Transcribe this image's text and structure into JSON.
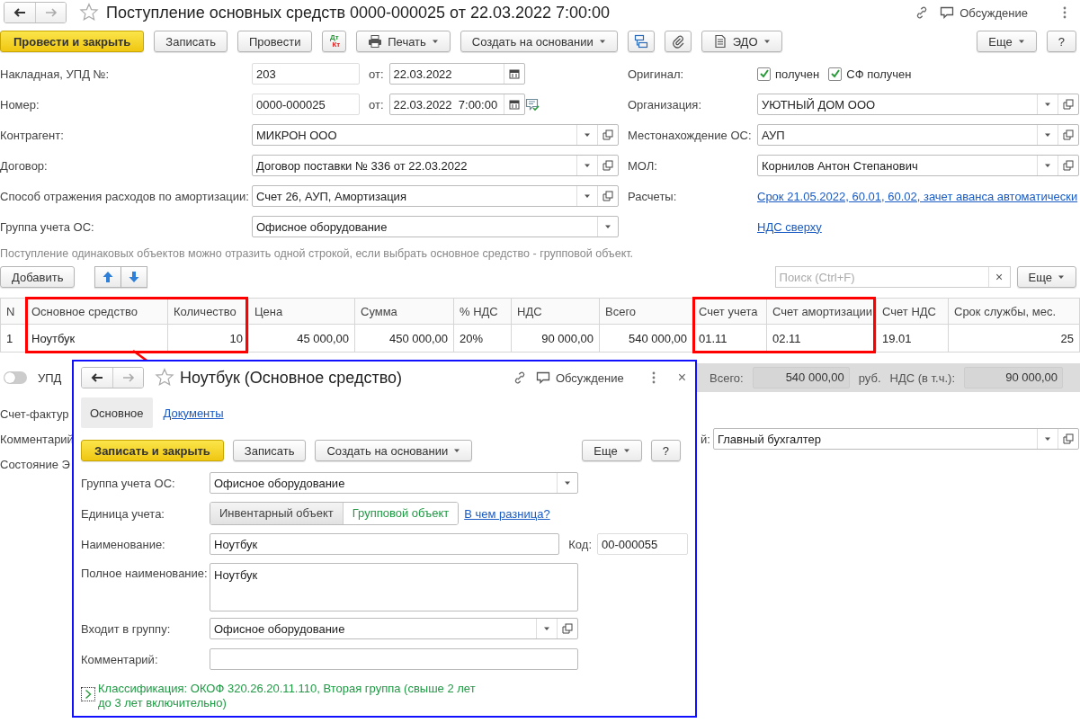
{
  "window": {
    "title": "Поступление основных средств 0000-000025 от 22.03.2022 7:00:00",
    "discussion": "Обсуждение"
  },
  "toolbar": [
    {
      "kind": "primary",
      "label": "Провести и закрыть"
    },
    {
      "kind": "button",
      "label": "Записать"
    },
    {
      "kind": "button",
      "label": "Провести"
    },
    {
      "kind": "dtkt",
      "top": "Дт",
      "bottom": "Кт"
    },
    {
      "kind": "print",
      "label": "Печать"
    },
    {
      "kind": "menu",
      "label": "Создать на основании"
    },
    {
      "kind": "structure"
    },
    {
      "kind": "attach"
    },
    {
      "kind": "edo",
      "label": "ЭДО"
    },
    {
      "kind": "more",
      "label": "Еще"
    },
    {
      "kind": "button",
      "label": "?"
    }
  ],
  "rows": [
    {
      "left": {
        "label": "Накладная, УПД №:",
        "controls": [
          {
            "kind": "short-input",
            "value": "203"
          },
          {
            "kind": "date",
            "label": "от:",
            "value": "22.03.2022"
          }
        ]
      },
      "right": {
        "label": "Оригинал:",
        "controls": [
          {
            "kind": "checkbox",
            "label": "получен",
            "checked": true
          },
          {
            "kind": "checkbox",
            "label": "СФ получен",
            "checked": true
          }
        ]
      }
    },
    {
      "left": {
        "label": "Номер:",
        "controls": [
          {
            "kind": "short-input",
            "value": "0000-000025"
          },
          {
            "kind": "date",
            "label": "от:",
            "value": "22.03.2022  7:00:00"
          },
          {
            "kind": "comment"
          }
        ]
      },
      "right": {
        "label": "Организация:",
        "controls": [
          {
            "kind": "select",
            "value": "УЮТНЫЙ ДОМ ООО",
            "open_button": true
          }
        ]
      }
    },
    {
      "left": {
        "label": "Контрагент:",
        "controls": [
          {
            "kind": "select",
            "value": "МИКРОН ООО",
            "open_button": true
          }
        ]
      },
      "right": {
        "label": "Местонахождение ОС:",
        "controls": [
          {
            "kind": "select",
            "value": "АУП",
            "open_button": true
          }
        ]
      }
    },
    {
      "left": {
        "label": "Договор:",
        "controls": [
          {
            "kind": "select",
            "value": "Договор поставки № 336 от 22.03.2022",
            "open_button": true
          }
        ]
      },
      "right": {
        "label": "МОЛ:",
        "controls": [
          {
            "kind": "select",
            "value": "Корнилов Антон Степанович",
            "open_button": true
          }
        ]
      }
    },
    {
      "left": {
        "label": "Способ отражения расходов по амортизации:",
        "controls": [
          {
            "kind": "select",
            "value": "Счет 26, АУП, Амортизация",
            "open_button": true
          }
        ]
      },
      "right": {
        "label": "Расчеты:",
        "controls": [
          {
            "kind": "link",
            "label": "Срок 21.05.2022, 60.01, 60.02, зачет аванса автоматически"
          }
        ]
      }
    },
    {
      "left": {
        "label": "Группа учета ОС:",
        "controls": [
          {
            "kind": "select",
            "value": "Офисное оборудование",
            "open_button": false
          }
        ]
      },
      "right": {
        "controls": [
          {
            "kind": "link",
            "label": "НДС сверху"
          }
        ]
      }
    }
  ],
  "hint": "Поступление одинаковых объектов можно отразить одной строкой, если выбрать основное средство - групповой объект.",
  "table": {
    "toolbar": {
      "add": "Добавить",
      "search_placeholder": "Поиск (Ctrl+F)",
      "clear": "×",
      "more": "Еще"
    },
    "columns": [
      {
        "title": "N",
        "highlighted": false
      },
      {
        "title": "Основное средство",
        "highlighted": true
      },
      {
        "title": "Количество",
        "highlighted": true
      },
      {
        "title": "Цена",
        "highlighted": false
      },
      {
        "title": "Сумма",
        "highlighted": false
      },
      {
        "title": "% НДС",
        "highlighted": false
      },
      {
        "title": "НДС",
        "highlighted": false
      },
      {
        "title": "Всего",
        "highlighted": false
      },
      {
        "title": "Счет учета",
        "highlighted": true
      },
      {
        "title": "Счет амортизации",
        "highlighted": true
      },
      {
        "title": "Счет НДС",
        "highlighted": false
      },
      {
        "title": "Срок службы, мес.",
        "highlighted": false
      }
    ],
    "rows": [
      [
        "1",
        "Ноутбук",
        "10",
        "45 000,00",
        "450 000,00",
        "20%",
        "90 000,00",
        "540 000,00",
        "01.11",
        "02.11",
        "19.01",
        "25"
      ]
    ]
  },
  "totals": {
    "upd_toggle": {
      "label": "УПД",
      "on": false
    },
    "items": [
      {
        "kind": "label",
        "text": "Всего:"
      },
      {
        "kind": "value",
        "text": "540 000,00"
      },
      {
        "kind": "label",
        "text": "руб."
      },
      {
        "kind": "label",
        "text": "НДС (в т.ч.):"
      },
      {
        "kind": "value",
        "text": "90 000,00"
      }
    ]
  },
  "lower": [
    {
      "label": "Счет-фактур"
    },
    {
      "label": "Комментарий",
      "right": {
        "label": "й:",
        "controls": [
          {
            "kind": "select",
            "value": "Главный бухгалтер",
            "open_button": true
          }
        ]
      }
    },
    {
      "label": "Состояние Э"
    }
  ],
  "popup": {
    "title": "Ноутбук (Основное средство)",
    "discussion": "Обсуждение",
    "close": "×",
    "tabs": [
      {
        "label": "Основное",
        "selected": true
      },
      {
        "label": "Документы",
        "selected": false
      }
    ],
    "toolbar": [
      {
        "kind": "primary",
        "label": "Записать и закрыть"
      },
      {
        "kind": "button",
        "label": "Записать"
      },
      {
        "kind": "menu",
        "label": "Создать на основании"
      },
      {
        "kind": "more",
        "label": "Еще"
      },
      {
        "kind": "button",
        "label": "?"
      }
    ],
    "rows": [
      {
        "label": "Группа учета ОС:",
        "controls": [
          {
            "kind": "select",
            "value": "Офисное оборудование",
            "open_button": false
          }
        ]
      },
      {
        "label": "Единица учета:",
        "controls": [
          {
            "kind": "segmented",
            "options": [
              {
                "label": "Инвентарный объект",
                "selected": false
              },
              {
                "label": "Групповой объект",
                "selected": true
              }
            ]
          },
          {
            "kind": "link",
            "label": "В чем разница?"
          }
        ]
      },
      {
        "label": "Наименование:",
        "controls": [
          {
            "kind": "input",
            "value": "Ноутбук"
          },
          {
            "kind": "short-input",
            "label": "Код:",
            "value": "00-000055"
          }
        ]
      },
      {
        "label": "Полное наименование:",
        "controls": [
          {
            "kind": "textarea",
            "value": "Ноутбук"
          }
        ]
      },
      {
        "label": "Входит в группу:",
        "controls": [
          {
            "kind": "select",
            "value": "Офисное оборудование",
            "open_button": true
          }
        ]
      },
      {
        "label": "Комментарий:",
        "controls": [
          {
            "kind": "input"
          }
        ]
      }
    ],
    "classification": {
      "expanded": false,
      "text": "Классификация: ОКОФ 320.26.20.11.110, Вторая группа (свыше 2 лет до 3 лет включительно)"
    }
  }
}
